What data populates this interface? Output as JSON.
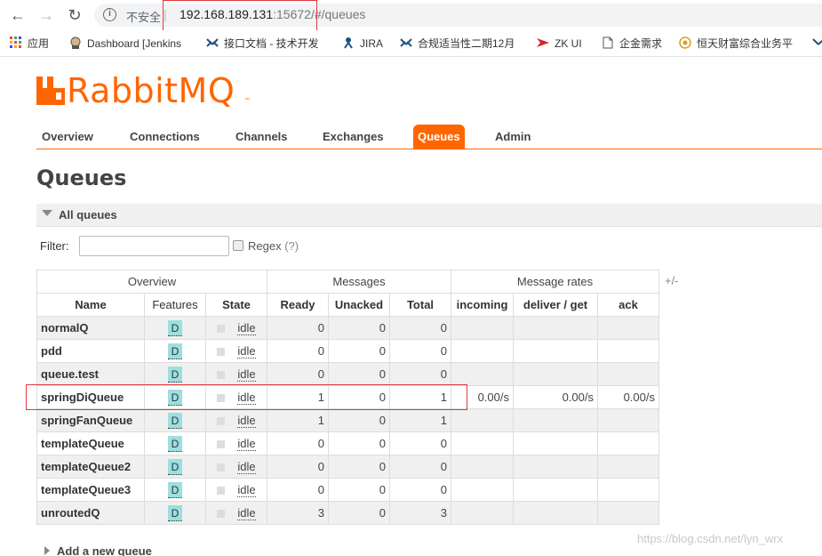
{
  "browser": {
    "back_icon": "arrow-left",
    "forward_icon": "arrow-right",
    "reload_icon": "reload",
    "insecure_label": "不安全",
    "url_host": "192.168.189.131",
    "url_port": ":15672",
    "url_path": "/#/queues"
  },
  "bookmarks": [
    {
      "label": "应用",
      "icon": "apps-grid"
    },
    {
      "label": "Dashboard [Jenkins",
      "icon": "jenkins"
    },
    {
      "label": "接口文档 - 技术开发",
      "icon": "confluence"
    },
    {
      "label": "JIRA",
      "icon": "jira"
    },
    {
      "label": "合规适当性二期12月",
      "icon": "confluence"
    },
    {
      "label": "ZK UI",
      "icon": "zk-arrow"
    },
    {
      "label": "企金需求",
      "icon": "page"
    },
    {
      "label": "恒天财富综合业务平",
      "icon": "hengtian"
    }
  ],
  "app": {
    "brand": "RabbitMQ",
    "brand_tm": "™",
    "nav_tabs": [
      "Overview",
      "Connections",
      "Channels",
      "Exchanges",
      "Queues",
      "Admin"
    ],
    "active_tab": "Queues",
    "accent_color": "#ff6600"
  },
  "page": {
    "title": "Queues",
    "section_label": "All queues",
    "filter_label": "Filter:",
    "filter_value": "",
    "regex_label": "Regex",
    "regex_help": "(?)",
    "plus_minus": "+/-",
    "add_queue_label": "Add a new queue"
  },
  "table": {
    "group_headers": [
      "Overview",
      "Messages",
      "Message rates"
    ],
    "columns": [
      "Name",
      "Features",
      "State",
      "Ready",
      "Unacked",
      "Total",
      "incoming",
      "deliver / get",
      "ack"
    ],
    "rows": [
      {
        "name": "normalQ",
        "features": "D",
        "state": "idle",
        "ready": "0",
        "unacked": "0",
        "total": "0",
        "incoming": "",
        "deliver_get": "",
        "ack": ""
      },
      {
        "name": "pdd",
        "features": "D",
        "state": "idle",
        "ready": "0",
        "unacked": "0",
        "total": "0",
        "incoming": "",
        "deliver_get": "",
        "ack": ""
      },
      {
        "name": "queue.test",
        "features": "D",
        "state": "idle",
        "ready": "0",
        "unacked": "0",
        "total": "0",
        "incoming": "",
        "deliver_get": "",
        "ack": ""
      },
      {
        "name": "springDiQueue",
        "features": "D",
        "state": "idle",
        "ready": "1",
        "unacked": "0",
        "total": "1",
        "incoming": "0.00/s",
        "deliver_get": "0.00/s",
        "ack": "0.00/s"
      },
      {
        "name": "springFanQueue",
        "features": "D",
        "state": "idle",
        "ready": "1",
        "unacked": "0",
        "total": "1",
        "incoming": "",
        "deliver_get": "",
        "ack": ""
      },
      {
        "name": "templateQueue",
        "features": "D",
        "state": "idle",
        "ready": "0",
        "unacked": "0",
        "total": "0",
        "incoming": "",
        "deliver_get": "",
        "ack": ""
      },
      {
        "name": "templateQueue2",
        "features": "D",
        "state": "idle",
        "ready": "0",
        "unacked": "0",
        "total": "0",
        "incoming": "",
        "deliver_get": "",
        "ack": ""
      },
      {
        "name": "templateQueue3",
        "features": "D",
        "state": "idle",
        "ready": "0",
        "unacked": "0",
        "total": "0",
        "incoming": "",
        "deliver_get": "",
        "ack": ""
      },
      {
        "name": "unroutedQ",
        "features": "D",
        "state": "idle",
        "ready": "3",
        "unacked": "0",
        "total": "3",
        "incoming": "",
        "deliver_get": "",
        "ack": ""
      }
    ]
  },
  "watermark": "https://blog.csdn.net/lyn_wrx"
}
